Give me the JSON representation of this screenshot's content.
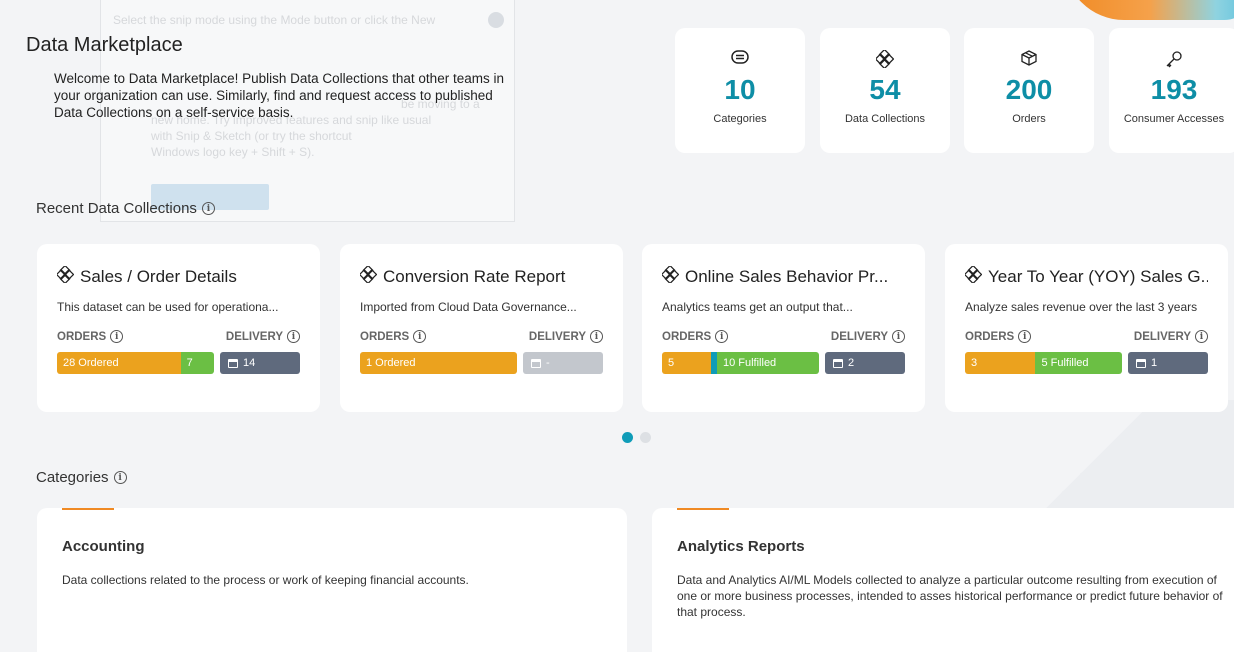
{
  "background_panel": {
    "lines": [
      "Select the snip mode using the Mode button or click the New",
      "be moving to a",
      "new home. Try improved features and snip like usual",
      "with Snip & Sketch (or try the shortcut",
      "Windows logo key + Shift + S)."
    ]
  },
  "page": {
    "title": "Data Marketplace",
    "welcome": "Welcome to Data Marketplace! Publish Data Collections that other teams in your organization can use. Similarly, find and request access to published Data Collections on a self-service basis."
  },
  "stats": [
    {
      "icon": "categories-icon",
      "value": "10",
      "label": "Categories"
    },
    {
      "icon": "data-collections-icon",
      "value": "54",
      "label": "Data Collections"
    },
    {
      "icon": "orders-box-icon",
      "value": "200",
      "label": "Orders"
    },
    {
      "icon": "key-icon",
      "value": "193",
      "label": "Consumer Accesses"
    }
  ],
  "recent": {
    "title": "Recent Data Collections",
    "orders_label": "ORDERS",
    "delivery_label": "DELIVERY",
    "cards": [
      {
        "title": "Sales / Order Details",
        "desc": "This dataset can be used for operationa...",
        "seg1": "28 Ordered",
        "seg2": "7",
        "seg3": "",
        "delivery": "14"
      },
      {
        "title": "Conversion Rate Report",
        "desc": "Imported from Cloud Data Governance...",
        "seg1": "1 Ordered",
        "seg2": "",
        "seg3": "",
        "delivery": "-"
      },
      {
        "title": "Online Sales Behavior Pr...",
        "desc": "Analytics teams get an output that...",
        "seg1": "5",
        "seg2": "",
        "seg3": "10 Fulfilled",
        "delivery": "2"
      },
      {
        "title": "Year To Year (YOY) Sales G...",
        "desc": "Analyze sales revenue over the last 3 years",
        "seg1": "3",
        "seg2": "",
        "seg3": "5 Fulfilled",
        "delivery": "1"
      }
    ]
  },
  "categories": {
    "title": "Categories",
    "items": [
      {
        "title": "Accounting",
        "desc": "Data collections related to the process or work of keeping financial accounts."
      },
      {
        "title": "Analytics Reports",
        "desc": "Data and Analytics AI/ML Models collected to analyze a particular outcome resulting from execution of one or more business processes, intended to asses historical performance or predict future behavior of that process."
      }
    ]
  },
  "colors": {
    "accent": "#0e8ea6",
    "ordered": "#eba21e",
    "fulfilled": "#6bbf44",
    "in_progress": "#0f9cb8",
    "delivery": "#5f6a7d",
    "category_accent": "#f08a24"
  }
}
